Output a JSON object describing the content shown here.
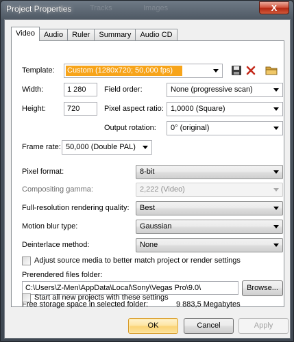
{
  "window": {
    "title": "Project Properties",
    "close_symbol": "X"
  },
  "background_ghost": [
    "Tracks",
    "Images"
  ],
  "tabs": [
    {
      "label": "Video",
      "active": true
    },
    {
      "label": "Audio",
      "active": false
    },
    {
      "label": "Ruler",
      "active": false
    },
    {
      "label": "Summary",
      "active": false
    },
    {
      "label": "Audio CD",
      "active": false
    }
  ],
  "video": {
    "template_label": "Template:",
    "template_value": "Custom (1280x720; 50,000 fps)",
    "width_label": "Width:",
    "width_value": "1 280",
    "height_label": "Height:",
    "height_value": "720",
    "field_order_label": "Field order:",
    "field_order_value": "None (progressive scan)",
    "pixel_aspect_label": "Pixel aspect ratio:",
    "pixel_aspect_value": "1,0000 (Square)",
    "output_rotation_label": "Output rotation:",
    "output_rotation_value": "0° (original)",
    "frame_rate_label": "Frame rate:",
    "frame_rate_value": "50,000 (Double PAL)",
    "pixel_format_label": "Pixel format:",
    "pixel_format_value": "8-bit",
    "compositing_gamma_label": "Compositing gamma:",
    "compositing_gamma_value": "2,222 (Video)",
    "render_quality_label": "Full-resolution rendering quality:",
    "render_quality_value": "Best",
    "motion_blur_label": "Motion blur type:",
    "motion_blur_value": "Gaussian",
    "deinterlace_label": "Deinterlace method:",
    "deinterlace_value": "None",
    "adjust_media_label": "Adjust source media to better match project or render settings",
    "adjust_media_checked": false,
    "prerendered_label": "Prerendered files folder:",
    "prerendered_path": "C:\\Users\\Z-Men\\AppData\\Local\\Sony\\Vegas Pro\\9.0\\",
    "browse_label": "Browse...",
    "free_space_label": "Free storage space in selected folder:",
    "free_space_value": "9 883,5 Megabytes",
    "start_new_label": "Start all new projects with these settings",
    "start_new_checked": false
  },
  "footer": {
    "ok_label": "OK",
    "cancel_label": "Cancel",
    "apply_label": "Apply"
  },
  "colors": {
    "template_highlight": "#f7a41a",
    "delete_icon": "#c42b1c",
    "default_button": "#fbd477"
  }
}
